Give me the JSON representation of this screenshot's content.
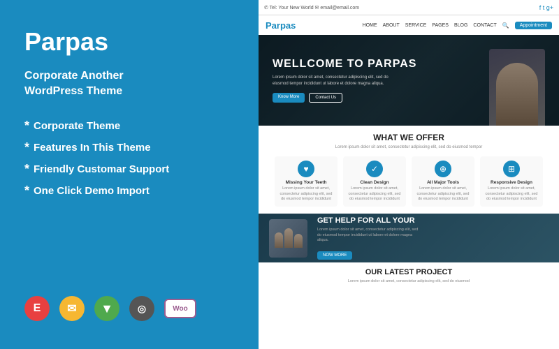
{
  "left": {
    "title": "Parpas",
    "subtitle": "Corporate Another\nWordPress Theme",
    "features": [
      "Corporate Theme",
      "Features In This Theme",
      "Friendly Customar Support",
      "One Click Demo Import"
    ]
  },
  "icons": [
    {
      "name": "elementor-icon",
      "label": "E"
    },
    {
      "name": "mailchimp-icon",
      "label": "✉"
    },
    {
      "name": "vuetify-icon",
      "label": "▼"
    },
    {
      "name": "headset-icon",
      "label": "◎"
    },
    {
      "name": "woo-icon",
      "label": "Woo"
    }
  ],
  "preview": {
    "topbar_left": "✆ Tel: Your New World   ✉ email@email.com",
    "topbar_right": "f  t  g+",
    "logo": "Parpas",
    "nav_links": [
      "HOME",
      "ABOUT",
      "SERVICE",
      "PAGES",
      "BLOG",
      "CONTACT"
    ],
    "nav_btn": "Appointment",
    "hero_title": "WELLCOME TO PARPAS",
    "hero_desc": "Lorem ipsum dolor sit amet, consectetur adipiscing elit, sed do eiusmod tempor incididunt ut labore et dolore magna aliqua.",
    "hero_btn1": "Know More",
    "hero_btn2": "Contact Us",
    "offers_title": "WHAT WE OFFER",
    "offers_desc": "Lorem ipsum dolor sit amet, consectetur adipiscing elit, sed do eiusmod tempor",
    "offers": [
      {
        "icon": "♥",
        "title": "Missing Your Teeth",
        "desc": "Lorem ipsum dolor sit amet, consectetur adipiscing elit, sed do eiusmod tempor incididunt"
      },
      {
        "icon": "✓",
        "title": "Clean Design",
        "desc": "Lorem ipsum dolor sit amet, consectetur adipiscing elit, sed do eiusmod tempor incididunt"
      },
      {
        "icon": "⊕",
        "title": "All Major Tools",
        "desc": "Lorem ipsum dolor sit amet, consectetur adipiscing elit, sed do eiusmod tempor incididunt"
      },
      {
        "icon": "⊞",
        "title": "Responsive Design",
        "desc": "Lorem ipsum dolor sit amet, consectetur adipiscing elit, sed do eiusmod tempor incididunt"
      }
    ],
    "cta_title": "GET HELP FOR ALL YOUR",
    "cta_desc": "Lorem ipsum dolor sit amet, consectetur adipiscing elit, sed do eiusmod tempor incididunt ut labore et dolore magna aliqua.",
    "cta_btn": "NOW MORE",
    "projects_title": "OUR LATEST PROJECT",
    "projects_desc": "Lorem ipsum dolor sit amet, consectetur adipiscing elit, sed do eiusmod"
  }
}
